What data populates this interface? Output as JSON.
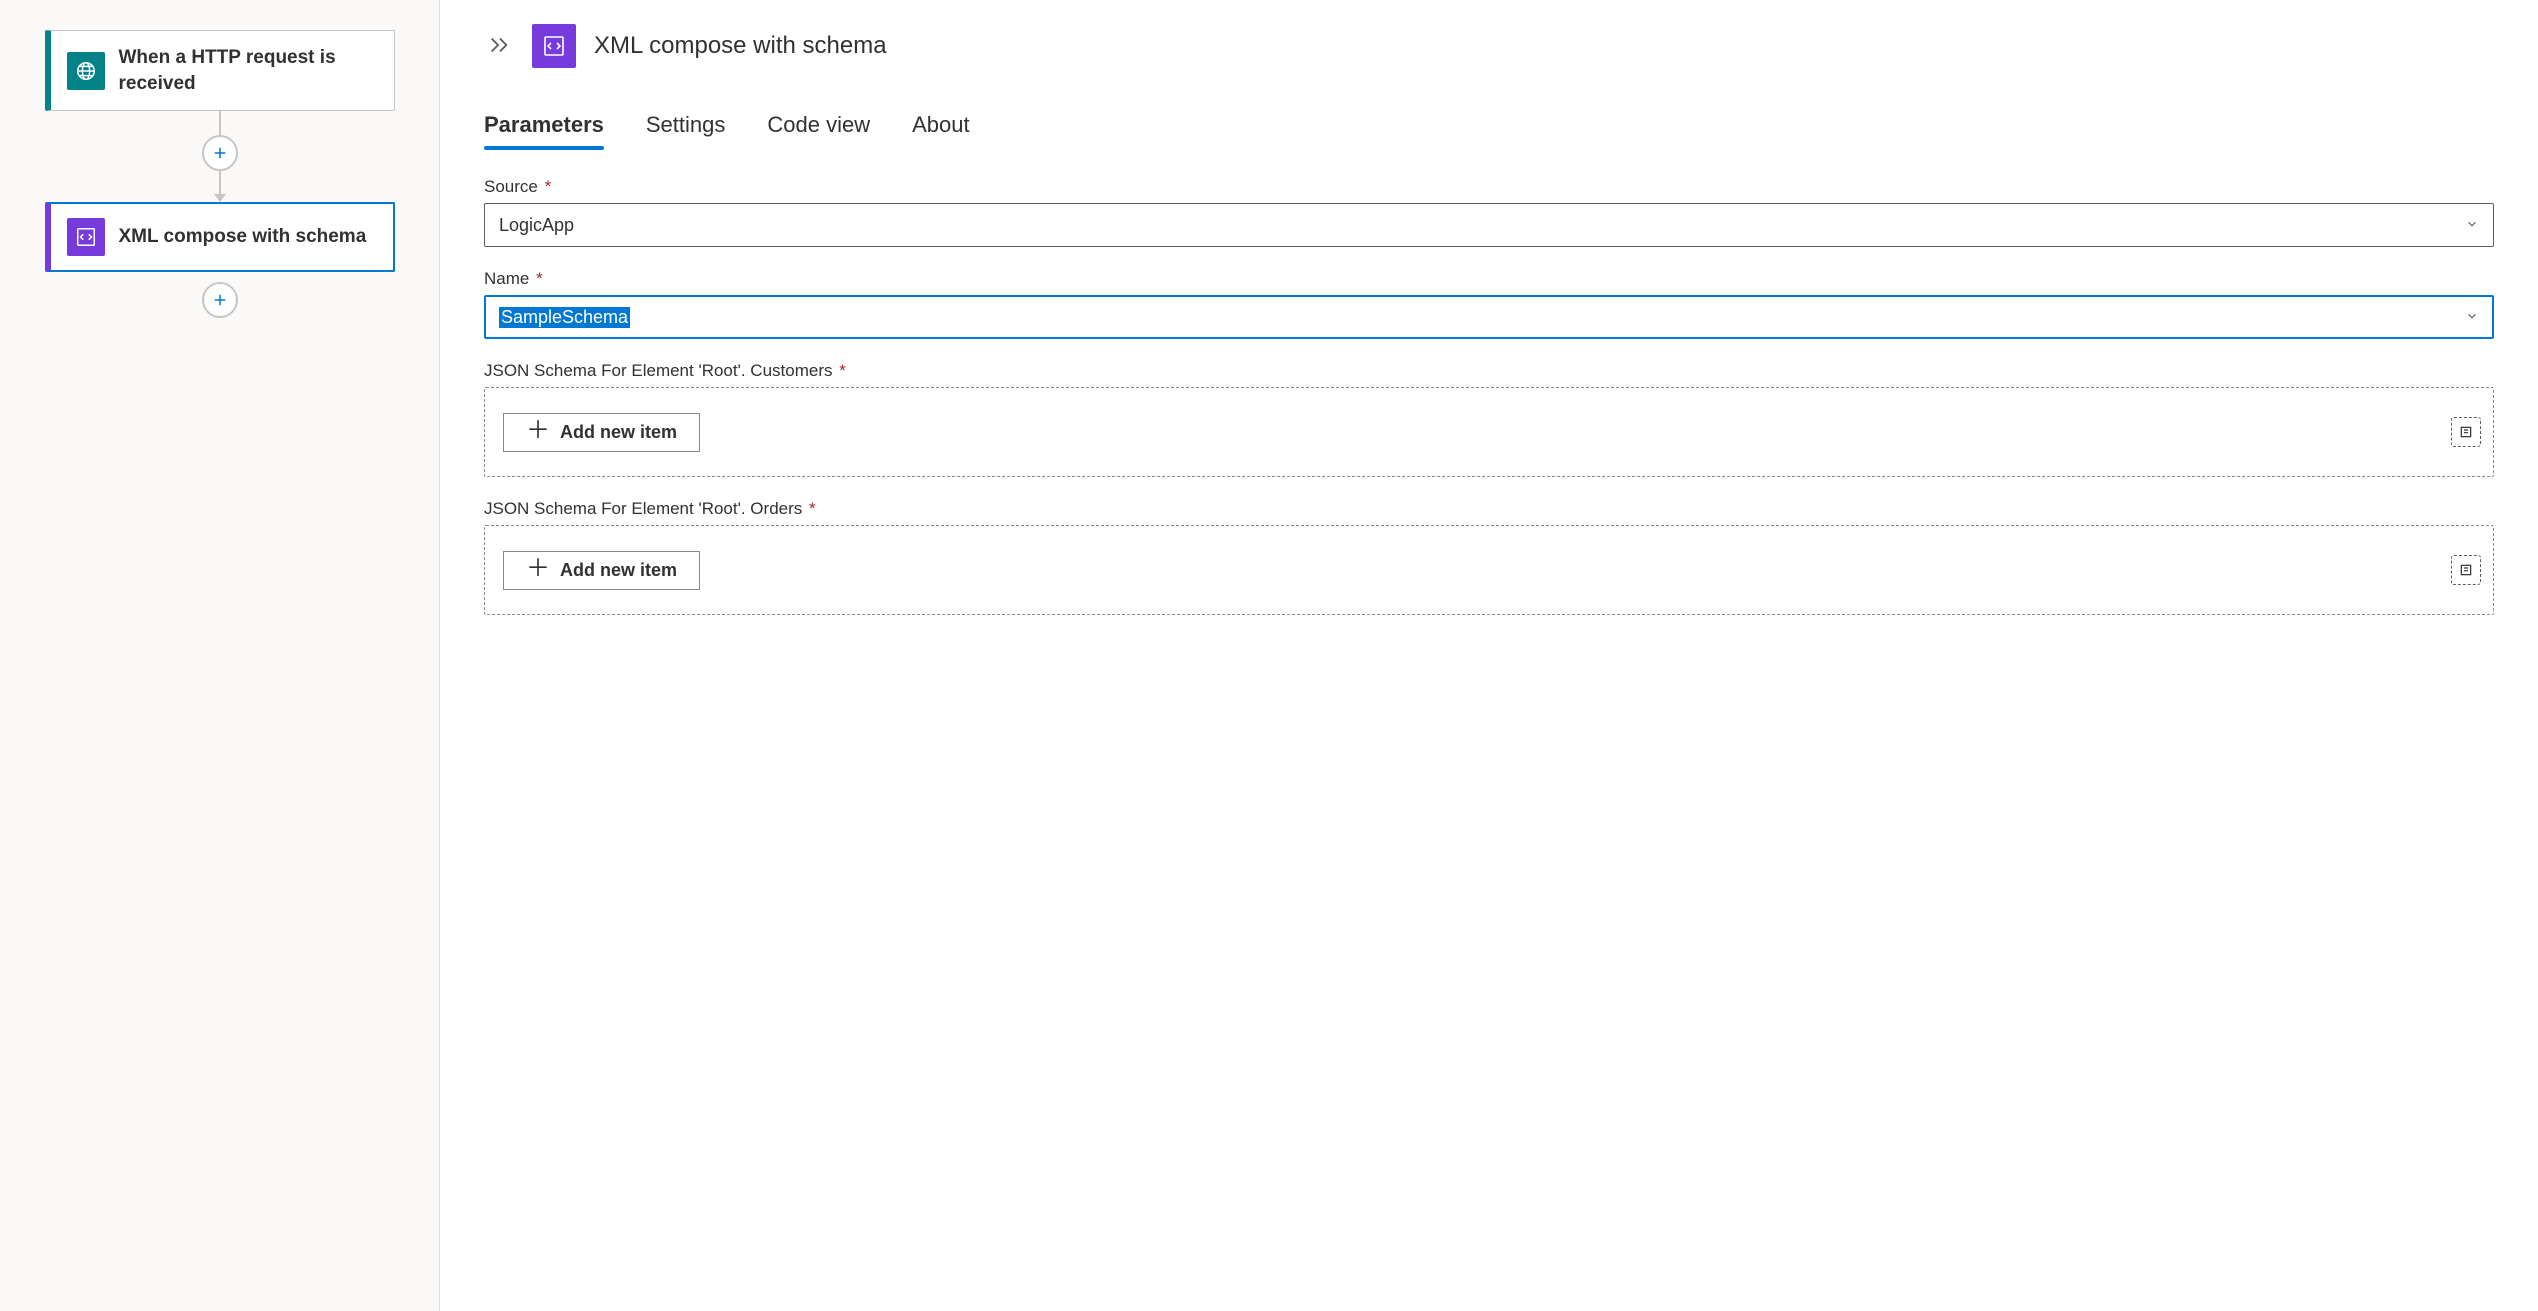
{
  "canvas": {
    "trigger": {
      "title": "When a HTTP request is received"
    },
    "action": {
      "title": "XML compose with schema"
    }
  },
  "details": {
    "title": "XML compose with schema",
    "tabs": {
      "parameters": "Parameters",
      "settings": "Settings",
      "codeview": "Code view",
      "about": "About"
    },
    "fields": {
      "source": {
        "label": "Source",
        "value": "LogicApp"
      },
      "name": {
        "label": "Name",
        "value": "SampleSchema"
      },
      "customers": {
        "label": "JSON Schema For Element 'Root'. Customers",
        "addLabel": "Add new item"
      },
      "orders": {
        "label": "JSON Schema For Element 'Root'. Orders",
        "addLabel": "Add new item"
      }
    }
  }
}
